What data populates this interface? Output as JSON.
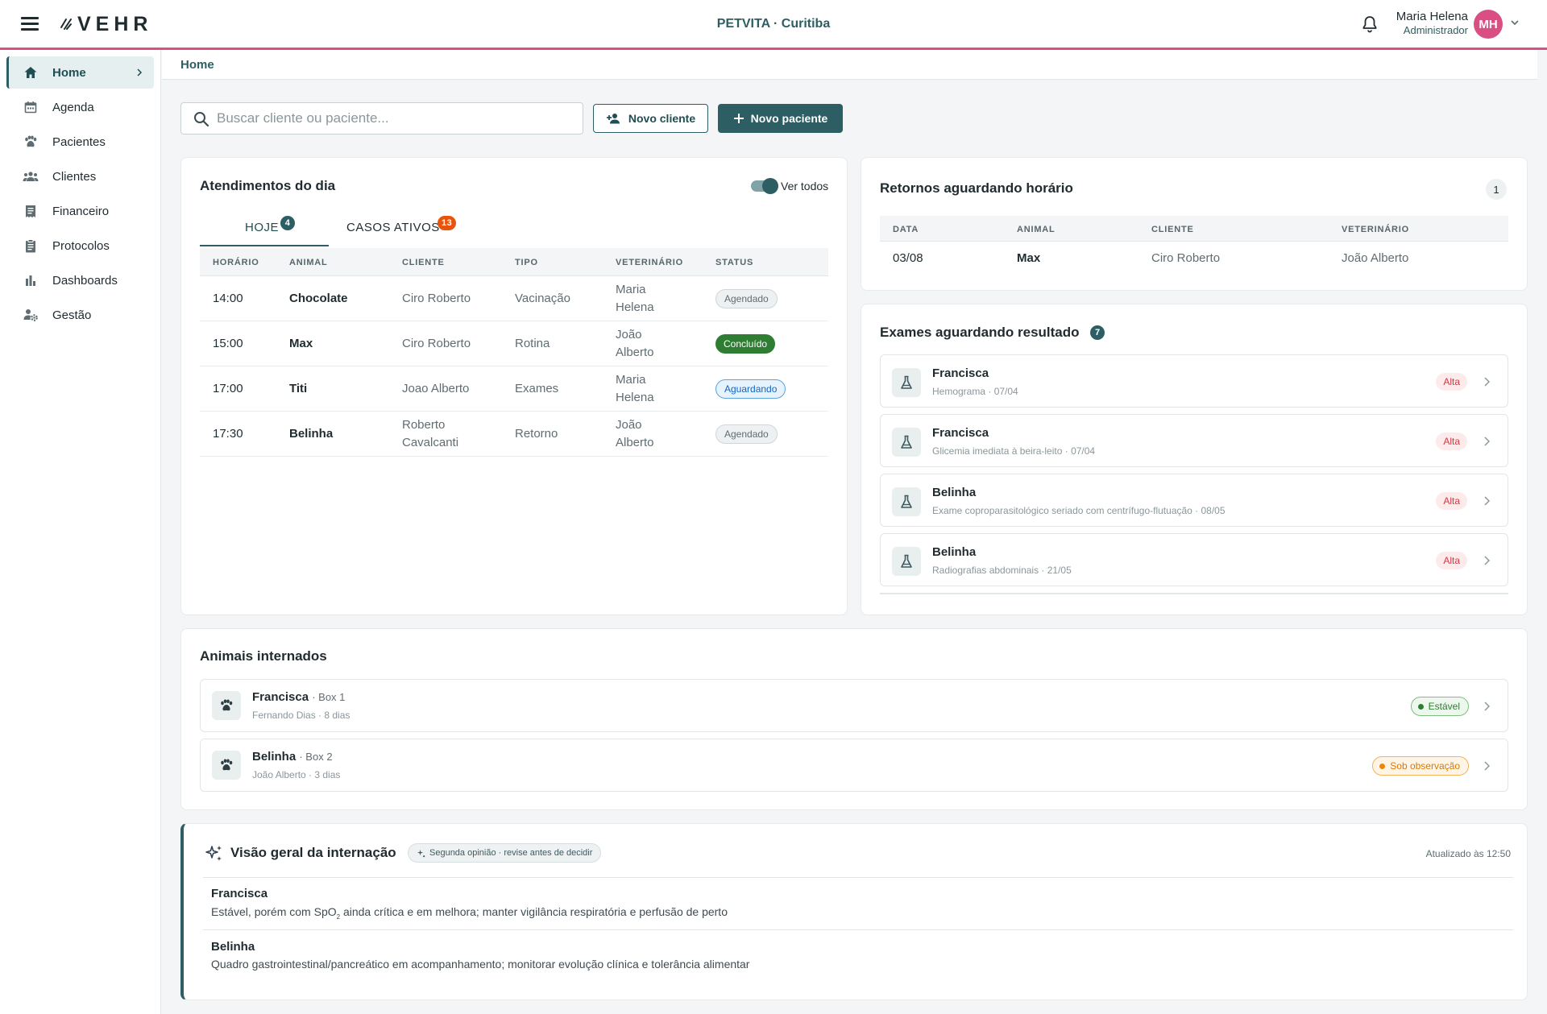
{
  "header": {
    "brand": "VEHR",
    "clinic": "PETVITA · Curitiba",
    "user_name": "Maria Helena",
    "user_role": "Administrador",
    "avatar_initials": "MH",
    "accent_color": "#d94f84"
  },
  "sidebar": {
    "items": [
      {
        "label": "Home",
        "icon": "home-icon"
      },
      {
        "label": "Agenda",
        "icon": "calendar-icon"
      },
      {
        "label": "Pacientes",
        "icon": "paw-icon"
      },
      {
        "label": "Clientes",
        "icon": "people-icon"
      },
      {
        "label": "Financeiro",
        "icon": "receipt-icon"
      },
      {
        "label": "Protocolos",
        "icon": "clipboard-icon"
      },
      {
        "label": "Dashboards",
        "icon": "bar-chart-icon"
      },
      {
        "label": "Gestão",
        "icon": "user-gear-icon"
      }
    ]
  },
  "breadcrumb": "Home",
  "toolbar": {
    "search_placeholder": "Buscar cliente ou paciente...",
    "new_client": "Novo cliente",
    "new_patient": "Novo paciente"
  },
  "atendimentos": {
    "title": "Atendimentos do dia",
    "toggle_label": "Ver todos",
    "tabs": [
      {
        "label": "HOJE",
        "badge": "4"
      },
      {
        "label": "CASOS ATIVOS",
        "badge": "13"
      }
    ],
    "columns": [
      "HORÁRIO",
      "ANIMAL",
      "CLIENTE",
      "TIPO",
      "VETERINÁRIO",
      "STATUS"
    ],
    "rows": [
      {
        "time": "14:00",
        "animal": "Chocolate",
        "client": "Ciro Roberto",
        "type": "Vacinação",
        "vet": "Maria Helena",
        "status": "Agendado"
      },
      {
        "time": "15:00",
        "animal": "Max",
        "client": "Ciro Roberto",
        "type": "Rotina",
        "vet": "João Alberto",
        "status": "Concluído"
      },
      {
        "time": "17:00",
        "animal": "Titi",
        "client": "Joao Alberto",
        "type": "Exames",
        "vet": "Maria Helena",
        "status": "Aguardando"
      },
      {
        "time": "17:30",
        "animal": "Belinha",
        "client": "Roberto Cavalcanti",
        "type": "Retorno",
        "vet": "João Alberto",
        "status": "Agendado"
      }
    ]
  },
  "retornos": {
    "title": "Retornos aguardando horário",
    "count": "1",
    "columns": [
      "DATA",
      "ANIMAL",
      "CLIENTE",
      "VETERINÁRIO"
    ],
    "rows": [
      {
        "date": "03/08",
        "animal": "Max",
        "client": "Ciro Roberto",
        "vet": "João Alberto"
      }
    ]
  },
  "exames": {
    "title": "Exames aguardando resultado",
    "count": "7",
    "items": [
      {
        "animal": "Francisca",
        "detail": "Hemograma · 07/04",
        "priority": "Alta"
      },
      {
        "animal": "Francisca",
        "detail": "Glicemia imediata à beira-leito · 07/04",
        "priority": "Alta"
      },
      {
        "animal": "Belinha",
        "detail": "Exame coproparasitológico seriado com centrífugo-flutuação · 08/05",
        "priority": "Alta"
      },
      {
        "animal": "Belinha",
        "detail": "Radiografias abdominais · 21/05",
        "priority": "Alta"
      }
    ]
  },
  "internados": {
    "title": "Animais internados",
    "items": [
      {
        "animal": "Francisca",
        "box": "· Box 1",
        "detail": "Fernando Dias · 8 dias",
        "state": "Estável"
      },
      {
        "animal": "Belinha",
        "box": "· Box 2",
        "detail": "João Alberto · 3 dias",
        "state": "Sob observação"
      }
    ]
  },
  "overview": {
    "title": "Visão geral da internação",
    "chip": "Segunda opinião · revise antes de decidir",
    "updated": "Atualizado às 12:50",
    "items": [
      {
        "animal": "Francisca",
        "text_before": "Estável, porém com SpO",
        "text_sub": "2",
        "text_after": " ainda crítica e em melhora; manter vigilância respiratória e perfusão de perto"
      },
      {
        "animal": "Belinha",
        "text": "Quadro gastrointestinal/pancreático em acompanhamento; monitorar evolução clínica e tolerância alimentar"
      }
    ]
  },
  "status_colors": {
    "Agendado": "#eef1f2",
    "Concluído": "#2e7d32",
    "Aguardando": "#e6f2fc",
    "Alta": "#d23a44",
    "Estável": "#2e7d32",
    "Sob observação": "#e8890c"
  }
}
